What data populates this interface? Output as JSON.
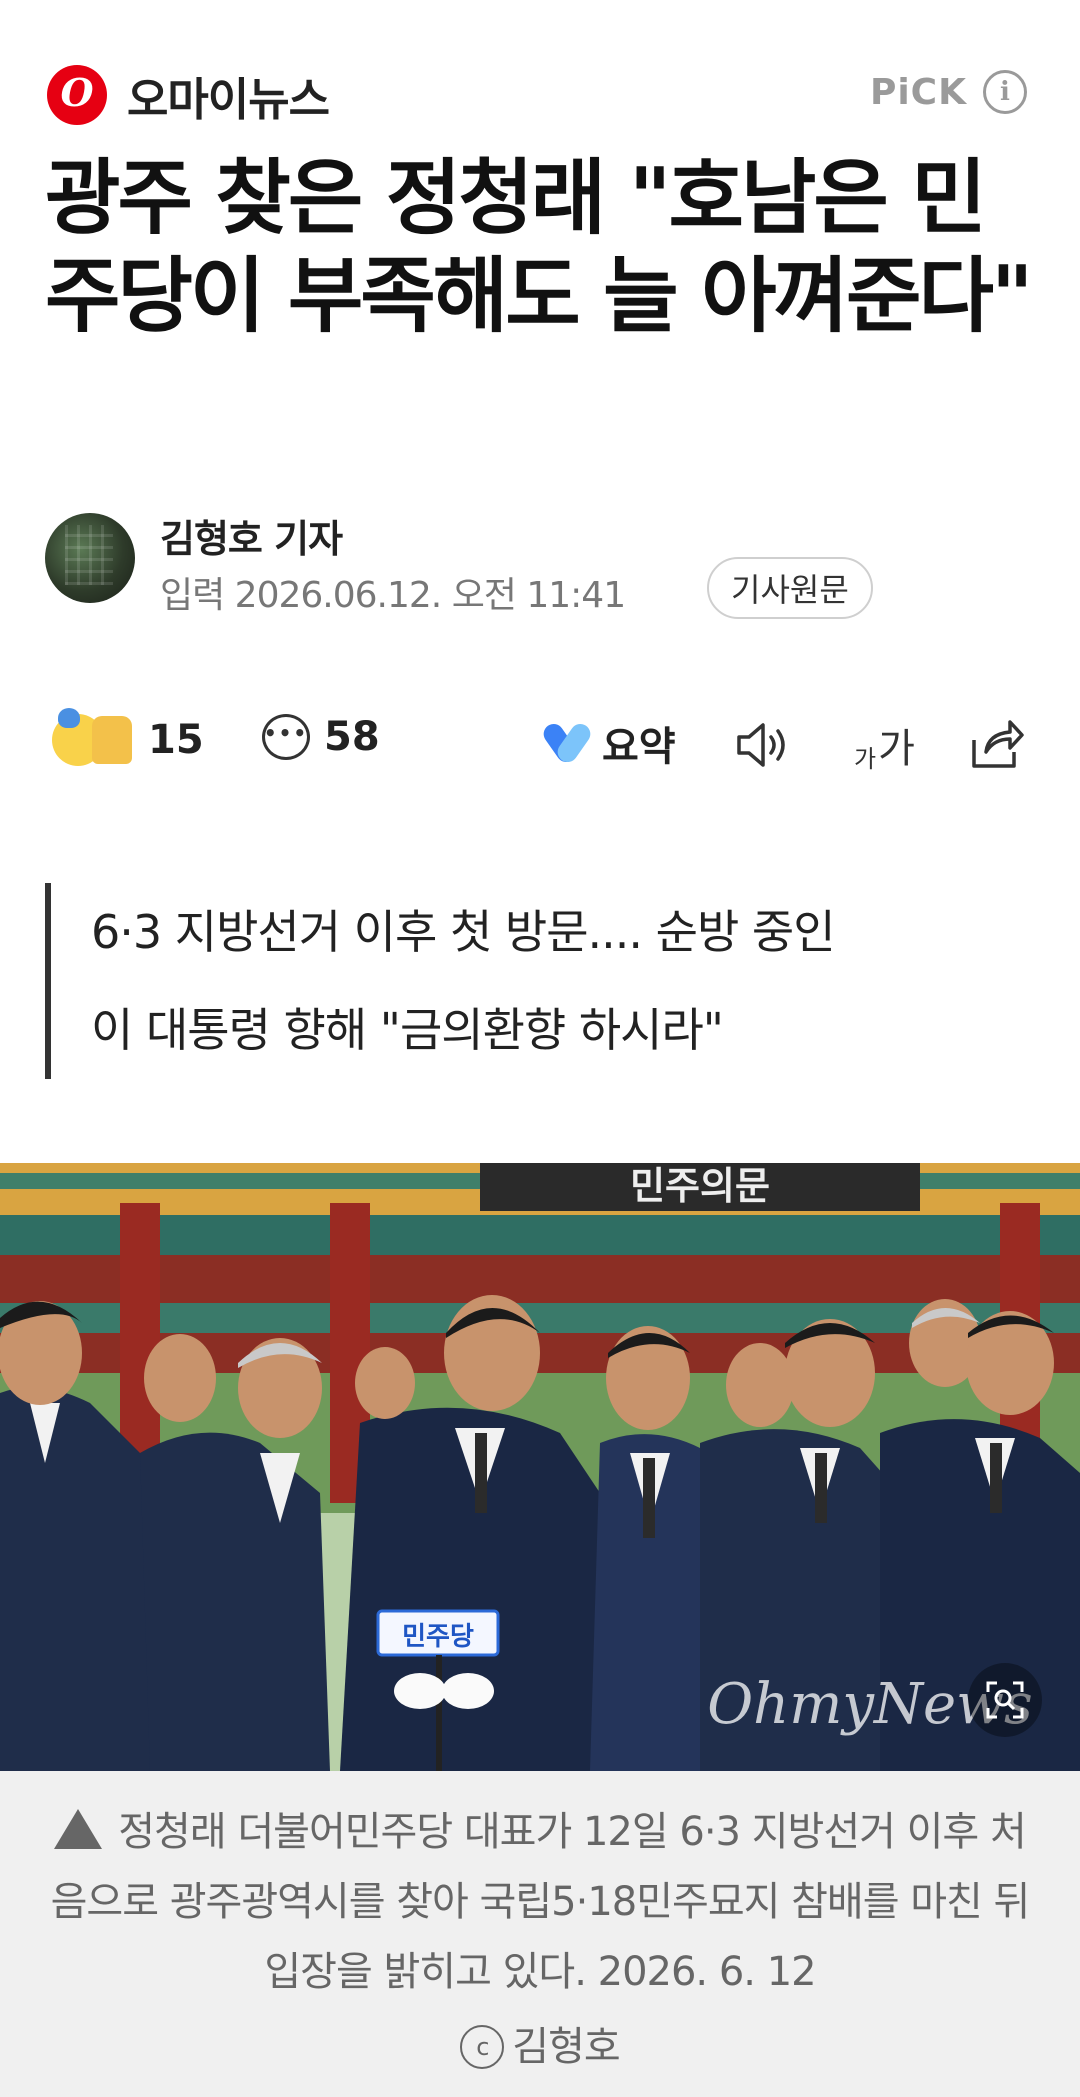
{
  "header": {
    "press_logo_letter": "O",
    "press_name": "오마이뉴스",
    "pick_label": "PiCK",
    "info_icon": "i"
  },
  "article": {
    "title": "광주 찾은 정청래 \"호남은 민주당이 부족해도 늘 아껴준다\"",
    "reporter": "김형호 기자",
    "date": "입력 2026.06.12. 오전 11:41",
    "original_button": "기사원문",
    "subtitle_line1": "6·3 지방선거 이후 첫 방문.... 순방 중인",
    "subtitle_line2": "이 대통령 향해 \"금의환향 하시라\""
  },
  "actions": {
    "reaction_count": "15",
    "comment_count": "58",
    "summary_label": "요약",
    "font_small": "가",
    "font_big": "가"
  },
  "photo": {
    "podium_sign": "민주당",
    "banner_text": "민주의문",
    "watermark": "OhmyNews"
  },
  "caption": {
    "text": "정청래 더불어민주당 대표가 12일 6·3 지방선거 이후 처음으로 광주광역시를 찾아 국립5·18민주묘지 참배를 마친 뒤 입장을 밝히고 있다. 2026. 6. 12",
    "credit_symbol": "ⓒ",
    "credit_name": "김형호"
  },
  "colors": {
    "brand_red": "#e60012",
    "text_dark": "#111111",
    "text_gray": "#777777",
    "caption_bg": "#f0f0f0"
  },
  "icons": {
    "reaction": "emoji-reaction-icon",
    "comment": "speech-bubble-icon",
    "summary": "summary-sparkle-icon",
    "tts": "speaker-icon",
    "font": "font-size-icon",
    "share": "share-icon",
    "zoom": "zoom-icon",
    "caption_marker": "triangle-up-icon"
  }
}
